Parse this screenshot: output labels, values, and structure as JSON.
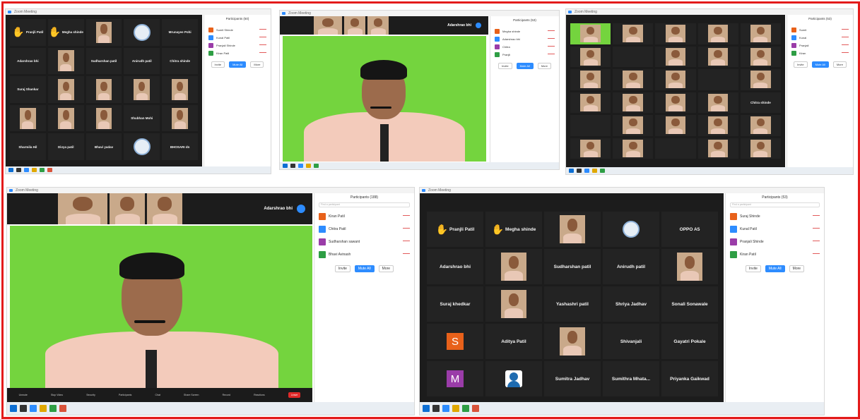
{
  "composite_title": "",
  "colors": {
    "frame": "#e31b1b",
    "zoom_blue": "#2d8cff",
    "green_screen": "#74d43e"
  },
  "shot1": {
    "window_title": "Zoom Meeting",
    "tiles": [
      {
        "name": "Pranjli Patil",
        "type": "hand"
      },
      {
        "name": "Megha shinde",
        "type": "hand"
      },
      {
        "name": "",
        "type": "video"
      },
      {
        "name": "",
        "type": "logo"
      },
      {
        "name": "Mrunayee Pohi",
        "type": "name"
      },
      {
        "name": "Adarshrao bhi",
        "type": "name"
      },
      {
        "name": "",
        "type": "video"
      },
      {
        "name": "Sudharshan patil",
        "type": "name"
      },
      {
        "name": "Anirudh patil",
        "type": "name"
      },
      {
        "name": "Chitra shinde",
        "type": "name"
      },
      {
        "name": "Suraj Shankar",
        "type": "name"
      },
      {
        "name": "",
        "type": "video"
      },
      {
        "name": "",
        "type": "video"
      },
      {
        "name": "",
        "type": "video"
      },
      {
        "name": "",
        "type": "video"
      },
      {
        "name": "",
        "type": "video"
      },
      {
        "name": "",
        "type": "video"
      },
      {
        "name": "",
        "type": "video"
      },
      {
        "name": "Shubhan Mohi",
        "type": "name"
      },
      {
        "name": "",
        "type": "video"
      },
      {
        "name": "Sharmila Hil",
        "type": "name"
      },
      {
        "name": "Divya patil",
        "type": "name"
      },
      {
        "name": "Bhavi yadav",
        "type": "name"
      },
      {
        "name": "",
        "type": "logo"
      },
      {
        "name": "BHOSARI dn",
        "type": "name"
      }
    ],
    "panel_title": "Participants (50)",
    "participants": [
      "Sumit Shinde",
      "Kunal Patil",
      "Pranjali Shinde",
      "Kiran Patil"
    ],
    "buttons": [
      "Invite",
      "Mute All",
      "More"
    ]
  },
  "shot2": {
    "window_title": "Zoom Meeting",
    "strip_name": "Adarshrao bhi",
    "panel_title": "Participants (53)",
    "participants": [
      "Megha shinde",
      "Adarshrao bhi",
      "Chitra",
      "Pranjli"
    ],
    "buttons": [
      "Invite",
      "Mute All",
      "More"
    ]
  },
  "shot3": {
    "window_title": "Zoom Meeting",
    "panel_title": "Participants (53)",
    "tile_label": "Chitra shinde",
    "participants": [
      "Sumit",
      "Kunal",
      "Pranjali",
      "Kiran"
    ],
    "buttons": [
      "Invite",
      "Mute All",
      "More"
    ]
  },
  "shot4": {
    "window_title": "Zoom Meeting",
    "strip_name": "Adarshrao bhi",
    "panel_title": "Participants (188)",
    "search_placeholder": "Find a participant",
    "participants": [
      "Kiran Patil",
      "Chitra Patil",
      "Sudharshan sawant",
      "Bhavi Avinash"
    ],
    "buttons": [
      "Invite",
      "Mute All",
      "More"
    ],
    "toolbar": [
      "Unmute",
      "Stop Video",
      "Security",
      "Participants",
      "Chat",
      "Share Screen",
      "Record",
      "Reactions",
      "Leave"
    ],
    "leave_label": "Leave"
  },
  "shot5": {
    "window_title": "Zoom Meeting",
    "panel_title": "Participants (53)",
    "search_placeholder": "Find a participant",
    "participants": [
      "Suraj Shinde",
      "Kunal Patil",
      "Pranjali Shinde",
      "Kiran Patil"
    ],
    "buttons": [
      "Invite",
      "Mute All",
      "More"
    ],
    "tiles": [
      {
        "name": "Pranjli Patil",
        "type": "hand"
      },
      {
        "name": "Megha shinde",
        "type": "hand"
      },
      {
        "name": "",
        "type": "video"
      },
      {
        "name": "",
        "type": "logo"
      },
      {
        "name": "OPPO A5",
        "type": "name"
      },
      {
        "name": "Adarshrao bhi",
        "type": "name"
      },
      {
        "name": "",
        "type": "video"
      },
      {
        "name": "Sudharshan patil",
        "type": "name"
      },
      {
        "name": "Anirudh patil",
        "type": "name"
      },
      {
        "name": "",
        "type": "video"
      },
      {
        "name": "Suraj khedkar",
        "type": "name"
      },
      {
        "name": "",
        "type": "video"
      },
      {
        "name": "Yashashri patil",
        "type": "name"
      },
      {
        "name": "Shriya Jadhav",
        "type": "name"
      },
      {
        "name": "Sonali Sonawale",
        "type": "name"
      },
      {
        "name": "S",
        "type": "avatar-s"
      },
      {
        "name": "Aditya Patil",
        "type": "name"
      },
      {
        "name": "",
        "type": "video"
      },
      {
        "name": "Shivanjali",
        "type": "name"
      },
      {
        "name": "Gayatri Pokale",
        "type": "name"
      },
      {
        "name": "M",
        "type": "avatar-m"
      },
      {
        "name": "",
        "type": "avatar-p"
      },
      {
        "name": "Sumitra Jadhav",
        "type": "name"
      },
      {
        "name": "Sumithra Mhata...",
        "type": "name"
      },
      {
        "name": "Priyanka Gaikwad",
        "type": "name"
      }
    ]
  }
}
